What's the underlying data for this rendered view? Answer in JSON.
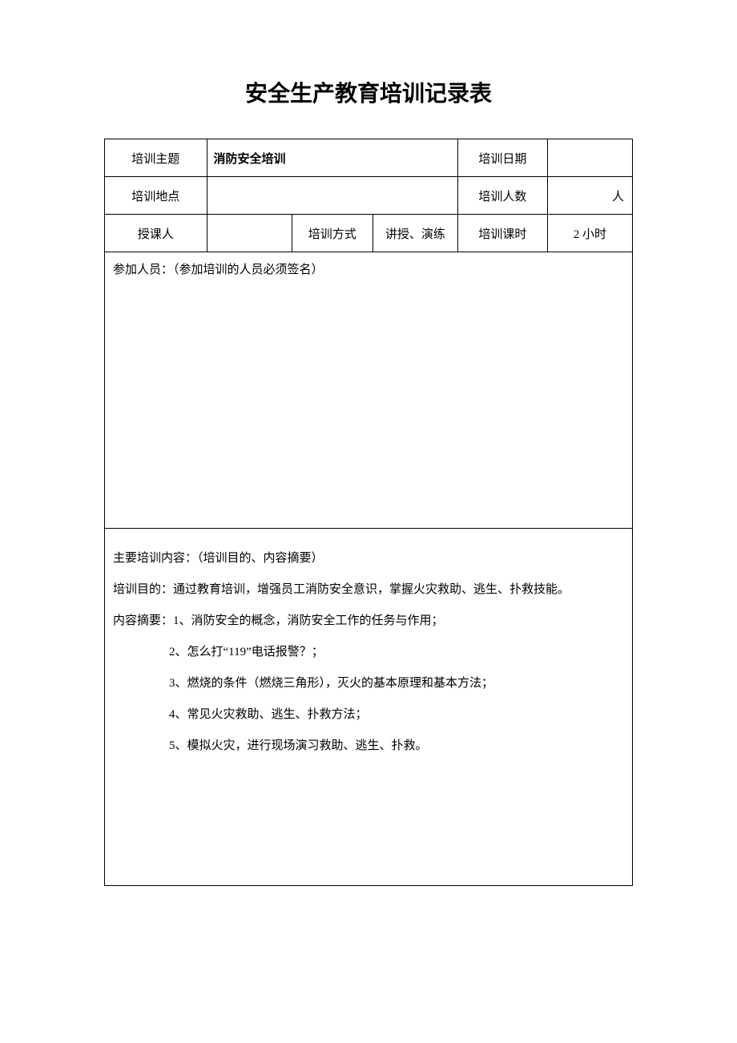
{
  "title": "安全生产教育培训记录表",
  "rows": {
    "r1": {
      "label1": "培训主题",
      "value1": "消防安全培训",
      "label2": "培训日期",
      "value2": ""
    },
    "r2": {
      "label1": "培训地点",
      "value1": "",
      "label2": "培训人数",
      "value2": "人"
    },
    "r3": {
      "label1": "授课人",
      "value1": "",
      "label2": "培训方式",
      "value2": "讲授、演练",
      "label3": "培训课时",
      "value3": "2 小时"
    }
  },
  "participants_header": "参加人员：（参加培训的人员必须签名）",
  "content": {
    "header": "主要培训内容：（培训目的、内容摘要）",
    "purpose": "培训目的：通过教育培训，增强员工消防安全意识，掌握火灾救助、逃生、扑救技能。",
    "summary_prefix": "内容摘要：1、消防安全的概念，消防安全工作的任务与作用；",
    "items": [
      "2、怎么打“119”电话报警？；",
      "3、燃烧的条件（燃烧三角形），灭火的基本原理和基本方法；",
      "4、常见火灾救助、逃生、扑救方法；",
      "5、模拟火灾，进行现场演习救助、逃生、扑救。"
    ]
  }
}
